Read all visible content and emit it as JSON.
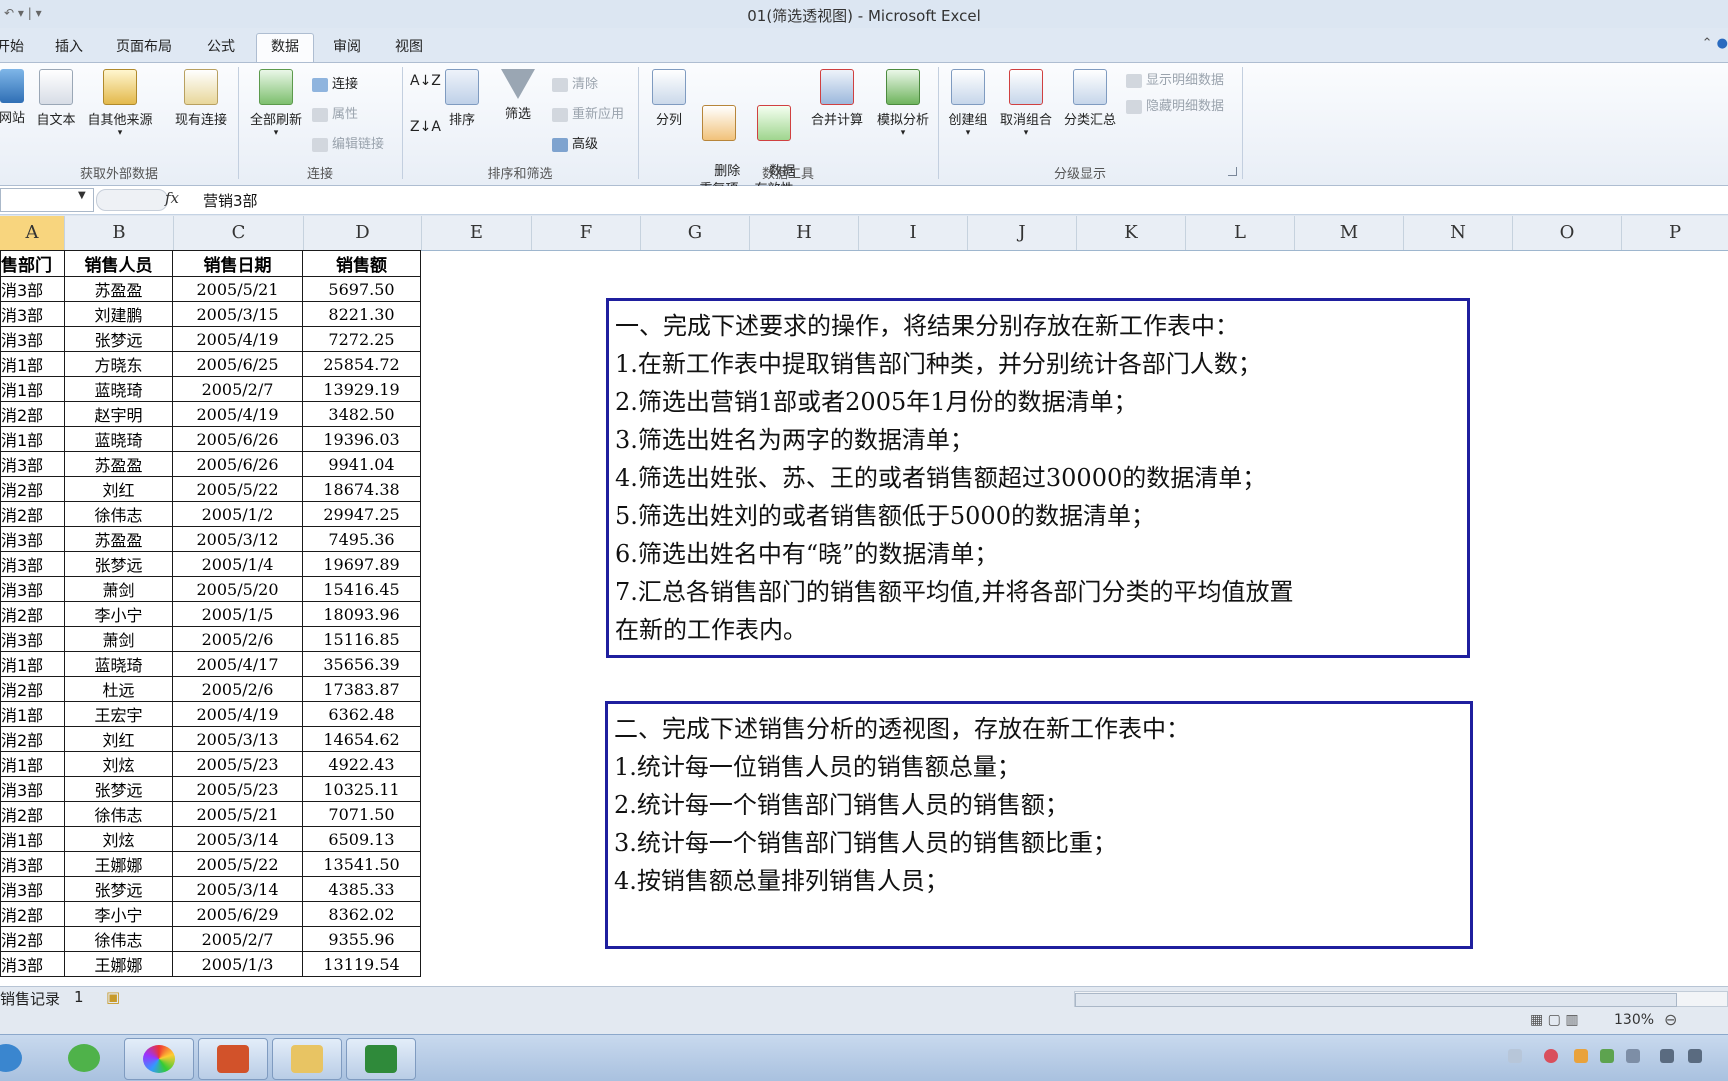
{
  "window": {
    "title": "01(筛选透视图) - Microsoft Excel",
    "qat_label": "↶ ▾ | ▾"
  },
  "tabs": [
    "开始",
    "插入",
    "页面布局",
    "公式",
    "数据",
    "审阅",
    "视图"
  ],
  "active_tab": "数据",
  "ribbon": {
    "groups": {
      "external": {
        "label": "获取外部数据",
        "buttons": [
          "网站",
          "自文本",
          "自其他来源",
          "现有连接"
        ]
      },
      "connections": {
        "label": "连接",
        "refresh": "全部刷新",
        "items": [
          "连接",
          "属性",
          "编辑链接"
        ]
      },
      "sort_filter": {
        "label": "排序和筛选",
        "sort": "排序",
        "filter": "筛选",
        "items": [
          "清除",
          "重新应用",
          "高级"
        ]
      },
      "data_tools": {
        "label": "数据工具",
        "buttons": [
          "分列",
          "删除\n重复项",
          "数据\n有效性",
          "合并计算",
          "模拟分析"
        ]
      },
      "outline": {
        "label": "分级显示",
        "buttons": [
          "创建组",
          "取消组合",
          "分类汇总"
        ],
        "items": [
          "显示明细数据",
          "隐藏明细数据"
        ]
      }
    }
  },
  "formula_bar": {
    "fx": "fx",
    "value": "营销3部"
  },
  "columns": [
    "A",
    "B",
    "C",
    "D",
    "E",
    "F",
    "G",
    "H",
    "I",
    "J",
    "K",
    "L",
    "M",
    "N",
    "O",
    "P"
  ],
  "table": {
    "headers": [
      "售部门",
      "销售人员",
      "销售日期",
      "销售额"
    ],
    "rows": [
      [
        "消3部",
        "苏盈盈",
        "2005/5/21",
        "5697.50"
      ],
      [
        "消3部",
        "刘建鹏",
        "2005/3/15",
        "8221.30"
      ],
      [
        "消3部",
        "张梦远",
        "2005/4/19",
        "7272.25"
      ],
      [
        "消1部",
        "方晓东",
        "2005/6/25",
        "25854.72"
      ],
      [
        "消1部",
        "蓝晓琦",
        "2005/2/7",
        "13929.19"
      ],
      [
        "消2部",
        "赵宇明",
        "2005/4/19",
        "3482.50"
      ],
      [
        "消1部",
        "蓝晓琦",
        "2005/6/26",
        "19396.03"
      ],
      [
        "消3部",
        "苏盈盈",
        "2005/6/26",
        "9941.04"
      ],
      [
        "消2部",
        "刘红",
        "2005/5/22",
        "18674.38"
      ],
      [
        "消2部",
        "徐伟志",
        "2005/1/2",
        "29947.25"
      ],
      [
        "消3部",
        "苏盈盈",
        "2005/3/12",
        "7495.36"
      ],
      [
        "消3部",
        "张梦远",
        "2005/1/4",
        "19697.89"
      ],
      [
        "消3部",
        "萧剑",
        "2005/5/20",
        "15416.45"
      ],
      [
        "消2部",
        "李小宁",
        "2005/1/5",
        "18093.96"
      ],
      [
        "消3部",
        "萧剑",
        "2005/2/6",
        "15116.85"
      ],
      [
        "消1部",
        "蓝晓琦",
        "2005/4/17",
        "35656.39"
      ],
      [
        "消2部",
        "杜远",
        "2005/2/6",
        "17383.87"
      ],
      [
        "消1部",
        "王宏宇",
        "2005/4/19",
        "6362.48"
      ],
      [
        "消2部",
        "刘红",
        "2005/3/13",
        "14654.62"
      ],
      [
        "消1部",
        "刘炫",
        "2005/5/23",
        "4922.43"
      ],
      [
        "消3部",
        "张梦远",
        "2005/5/23",
        "10325.11"
      ],
      [
        "消2部",
        "徐伟志",
        "2005/5/21",
        "7071.50"
      ],
      [
        "消1部",
        "刘炫",
        "2005/3/14",
        "6509.13"
      ],
      [
        "消3部",
        "王娜娜",
        "2005/5/22",
        "13541.50"
      ],
      [
        "消3部",
        "张梦远",
        "2005/3/14",
        "4385.33"
      ],
      [
        "消2部",
        "李小宁",
        "2005/6/29",
        "8362.02"
      ],
      [
        "消2部",
        "徐伟志",
        "2005/2/7",
        "9355.96"
      ],
      [
        "消3部",
        "王娜娜",
        "2005/1/3",
        "13119.54"
      ]
    ]
  },
  "textbox1": [
    "一、完成下述要求的操作，将结果分别存放在新工作表中：",
    "1.在新工作表中提取销售部门种类，并分别统计各部门人数；",
    "2.筛选出营销1部或者2005年1月份的数据清单；",
    "3.筛选出姓名为两字的数据清单；",
    "4.筛选出姓张、苏、王的或者销售额超过30000的数据清单；",
    "5.筛选出姓刘的或者销售额低于5000的数据清单；",
    "6.筛选出姓名中有“晓”的数据清单；",
    "7.汇总各销售部门的销售额平均值,并将各部门分类的平均值放置",
    "在新的工作表内。"
  ],
  "textbox2": [
    "二、完成下述销售分析的透视图，存放在新工作表中：",
    "1.统计每一位销售人员的销售额总量；",
    "2.统计每一个销售部门销售人员的销售额；",
    "3.统计每一个销售部门销售人员的销售额比重；",
    "4.按销售额总量排列销售人员；"
  ],
  "sheet_tabs": [
    "销售记录",
    "1"
  ],
  "status": {
    "zoom": "130%"
  },
  "colors": {
    "accent": "#1f1f9e",
    "selected_col": "#f8d57e"
  }
}
